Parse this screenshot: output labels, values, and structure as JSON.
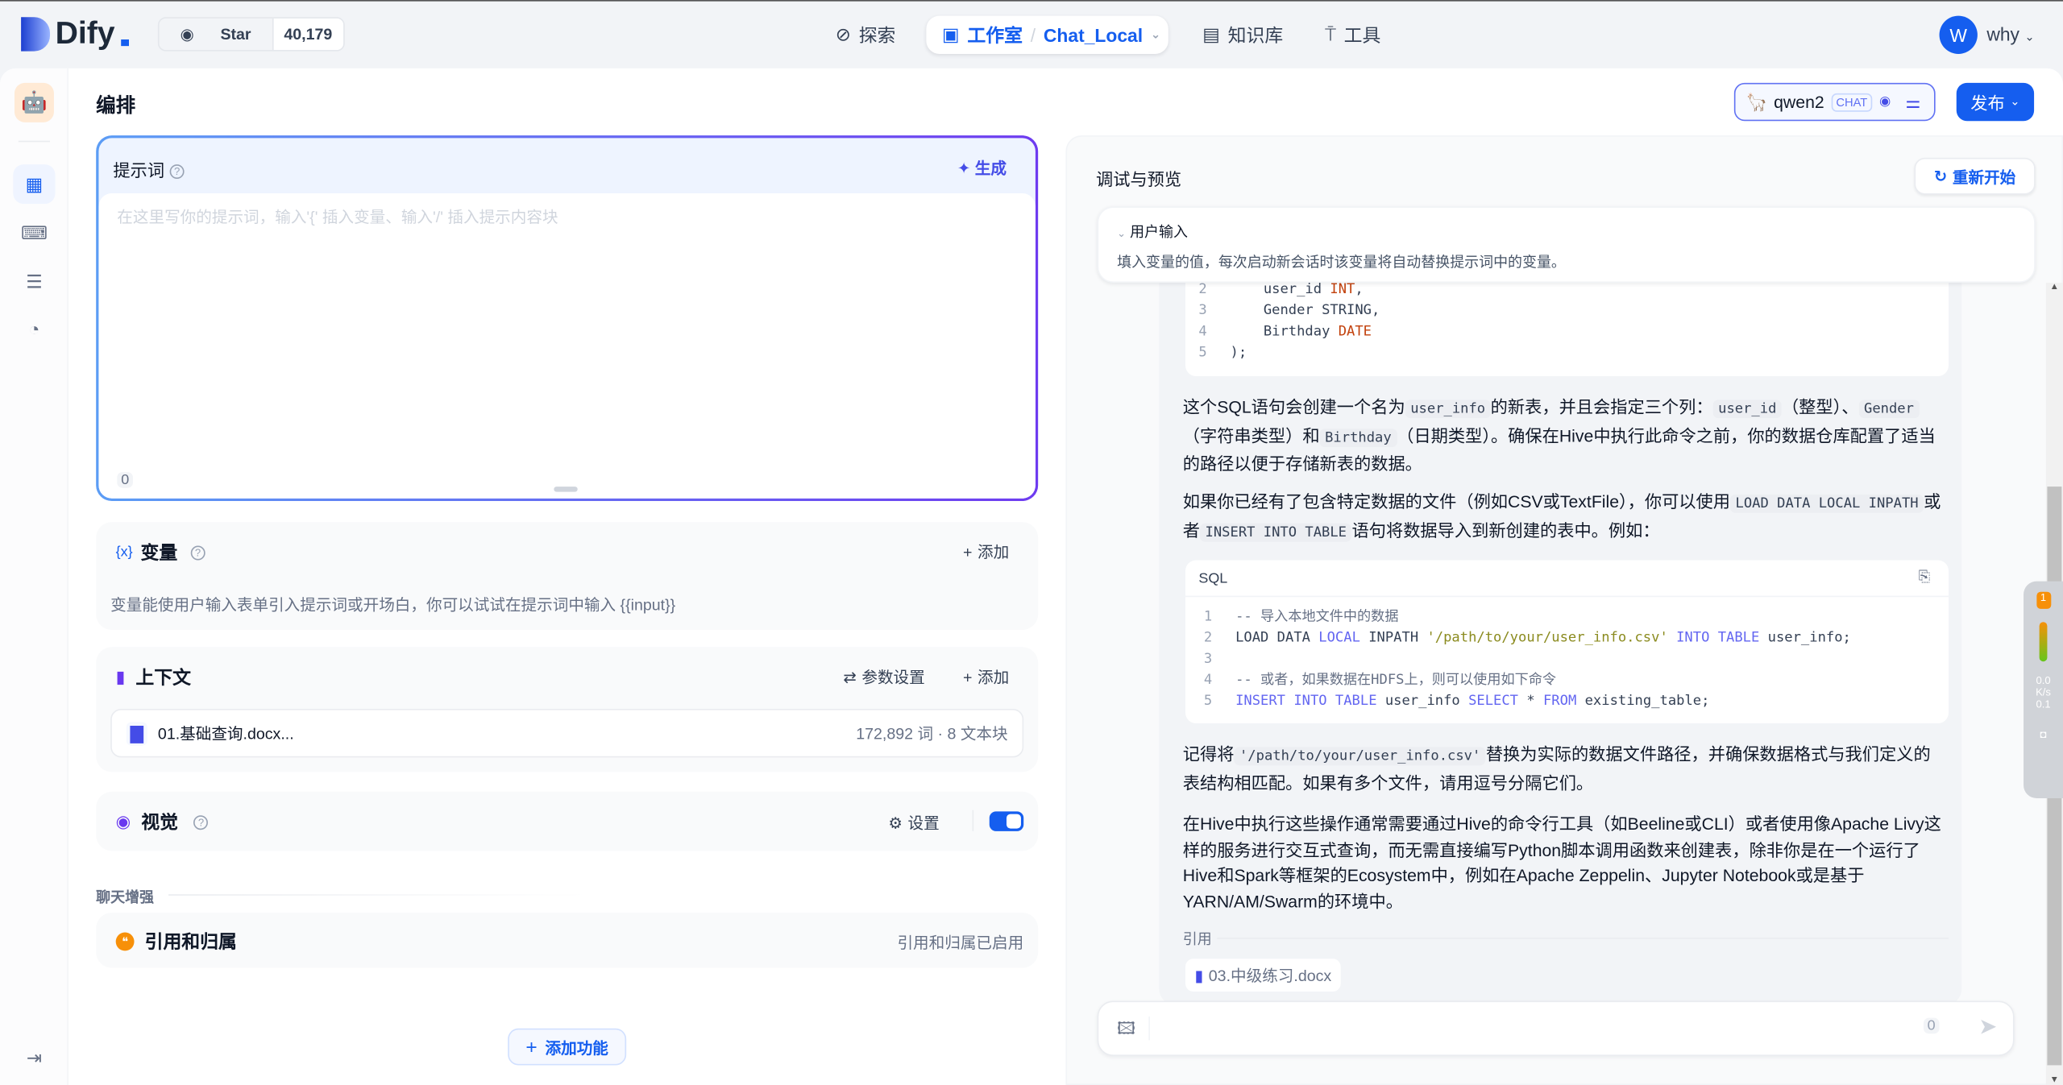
{
  "topbar": {
    "brand": "Dify",
    "star_label": "Star",
    "star_count": "40,179",
    "nav": {
      "explore": "探索",
      "studio": "工作室",
      "app_name": "Chat_Local",
      "knowledge": "知识库",
      "tools": "工具"
    },
    "user": {
      "initial": "W",
      "name": "why"
    }
  },
  "header": {
    "title": "编排",
    "model": {
      "name": "qwen2",
      "mode_badge": "CHAT"
    },
    "publish": "发布"
  },
  "prompt": {
    "title": "提示词",
    "generate": "生成",
    "placeholder": "在这里写你的提示词，输入'{' 插入变量、输入'/' 插入提示内容块",
    "char_count": "0"
  },
  "variables": {
    "title": "变量",
    "add": "添加",
    "description": "变量能使用户输入表单引入提示词或开场白，你可以试试在提示词中输入 {{input}}"
  },
  "context": {
    "title": "上下文",
    "params": "参数设置",
    "add": "添加",
    "item": {
      "name": "01.基础查询.docx...",
      "meta": "172,892 词 · 8 文本块"
    }
  },
  "vision": {
    "title": "视觉",
    "settings": "设置",
    "enabled": true
  },
  "chat_enhance": {
    "section": "聊天增强",
    "citation": {
      "title": "引用和归属",
      "status": "引用和归属已启用"
    }
  },
  "add_feature": "添加功能",
  "debug": {
    "title": "调试与预览",
    "restart": "重新开始",
    "user_input": {
      "title": "用户输入",
      "description": "填入变量的值，每次启动新会话时该变量将自动替换提示词中的变量。"
    },
    "code1": [
      {
        "n": "2",
        "a": "    user_id ",
        "b": "INT",
        "c": ","
      },
      {
        "n": "3",
        "a": "    Gender STRING,",
        "b": "",
        "c": ""
      },
      {
        "n": "4",
        "a": "    Birthday ",
        "b": "DATE",
        "c": ""
      },
      {
        "n": "5",
        "a": ");",
        "b": "",
        "c": ""
      }
    ],
    "p1": {
      "t1": "这个SQL语句会创建一个名为",
      "c1": "user_info",
      "t2": "的新表，并且会指定三个列：",
      "c2": "user_id",
      "t3": "（整型）、",
      "c3": "Gender",
      "t4": "（字符串类型）和",
      "c4": "Birthday",
      "t5": "（日期类型）。确保在Hive中执行此命令之前，你的数据仓库配置了适当的路径以便于存储新表的数据。"
    },
    "p2": {
      "t1": "如果你已经有了包含特定数据的文件（例如CSV或TextFile），你可以使用",
      "c1": "LOAD DATA LOCAL INPATH",
      "t2": "或者",
      "c2": "INSERT INTO TABLE",
      "t3": "语句将数据导入到新创建的表中。例如："
    },
    "sql": {
      "lang": "SQL",
      "lines": [
        {
          "n": "1",
          "comment": "-- 导入本地文件中的数据"
        },
        {
          "n": "2",
          "p1": "LOAD DATA ",
          "k1": "LOCAL",
          "p2": " INPATH ",
          "s": "'/path/to/your/user_info.csv'",
          "k2": " INTO TABLE",
          "p3": " user_info;"
        },
        {
          "n": "3"
        },
        {
          "n": "4",
          "comment": "-- 或者，如果数据在HDFS上，则可以使用如下命令"
        },
        {
          "n": "5",
          "k1": "INSERT INTO TABLE",
          "p2": " user_info ",
          "k2": "SELECT",
          "p3": " * ",
          "k3": "FROM",
          "p4": " existing_table;"
        }
      ]
    },
    "p3": {
      "t1": "记得将",
      "c1": "'/path/to/your/user_info.csv'",
      "t2": "替换为实际的数据文件路径，并确保数据格式与我们定义的表结构相匹配。如果有多个文件，请用逗号分隔它们。"
    },
    "p4": "在Hive中执行这些操作通常需要通过Hive的命令行工具（如Beeline或CLI）或者使用像Apache Livy这样的服务进行交互式查询，而无需直接编写Python脚本调用函数来创建表，除非你是在一个运行了Hive和Spark等框架的Ecosystem中，例如在Apache Zeppelin、Jupyter Notebook或是基于YARN/AM/Swarm的环境中。",
    "citation_label": "引用",
    "citation_file": "03.中级练习.docx",
    "input_count": "0"
  },
  "widget": {
    "badge": "1",
    "up": "0.0",
    "down": "0.1",
    "unit": "K/s"
  },
  "colors": {
    "primary": "#155eef",
    "accent_purple": "#6938ef",
    "citation_orange": "#f79009"
  }
}
